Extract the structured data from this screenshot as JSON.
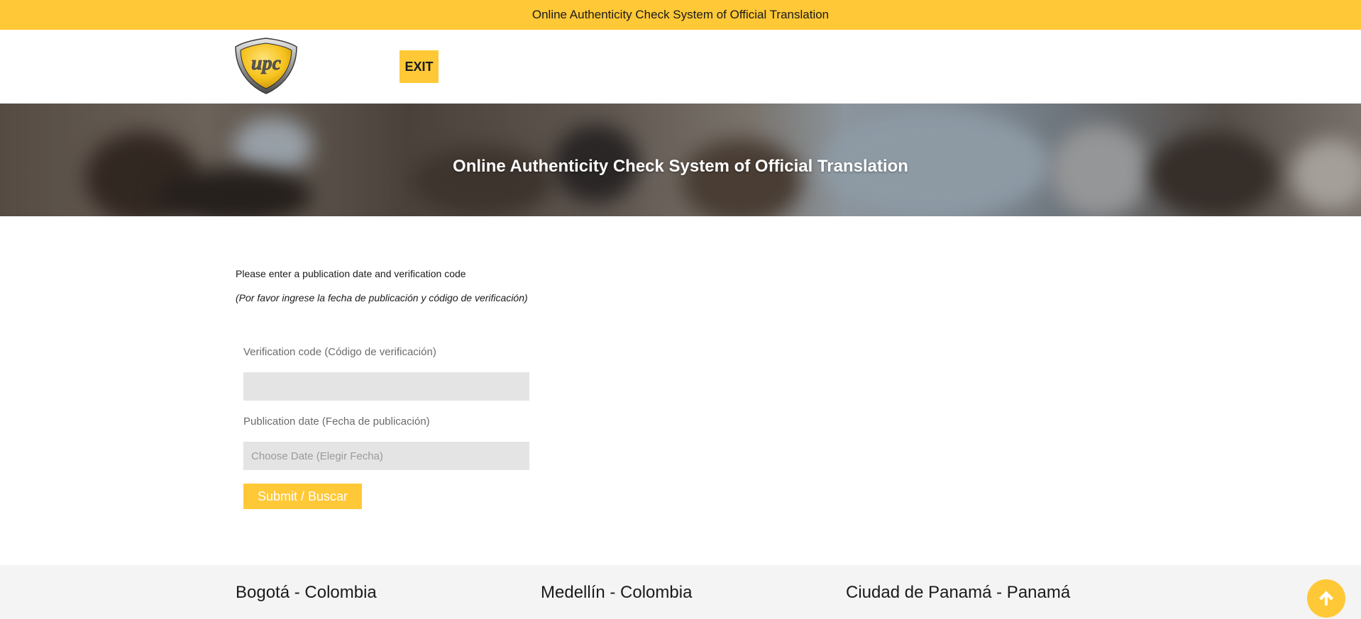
{
  "banner": {
    "text": "Online Authenticity Check System of Official Translation"
  },
  "header": {
    "logo_text": "upc",
    "exit_label": "EXIT"
  },
  "hero": {
    "title": "Online Authenticity Check System of Official Translation"
  },
  "instructions": {
    "en": "Please enter a publication date and verification code",
    "es": "(Por favor ingrese la fecha de publicación y código de verificación)"
  },
  "form": {
    "verification_code": {
      "label": "Verification code (Código de verificación)",
      "value": "",
      "placeholder": ""
    },
    "publication_date": {
      "label": "Publication date (Fecha de publicación)",
      "value": "",
      "placeholder": "Choose Date (Elegir Fecha)"
    },
    "submit_label": "Submit / Buscar"
  },
  "footer": {
    "cities": [
      "Bogotá - Colombia",
      "Medellín - Colombia",
      "Ciudad de Panamá - Panamá"
    ]
  },
  "icons": {
    "scroll_top": "arrow-up-icon",
    "logo": "upc-shield-logo"
  },
  "colors": {
    "accent": "#ffc837",
    "input_bg": "#e4e4e4",
    "footer_bg": "#f4f4f4"
  }
}
